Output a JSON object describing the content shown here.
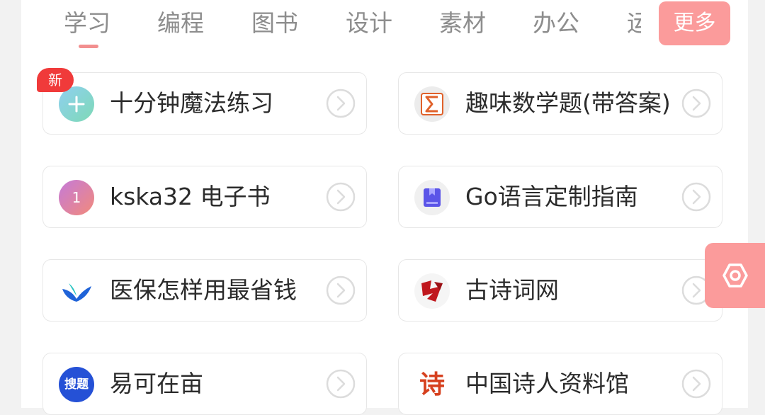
{
  "tabs": [
    "学习",
    "编程",
    "图书",
    "设计",
    "素材",
    "办公",
    "运"
  ],
  "more_label": "更多",
  "badge_new": "新",
  "cards": [
    {
      "title": "十分钟魔法练习",
      "icon": "plus-circle-icon"
    },
    {
      "title": "趣味数学题(带答案)",
      "icon": "sigma-icon"
    },
    {
      "title": "kska32 电子书",
      "icon": "number-one-icon",
      "icon_text": "1"
    },
    {
      "title": "Go语言定制指南",
      "icon": "bookmark-icon"
    },
    {
      "title": "医保怎样用最省钱",
      "icon": "bird-logo-icon"
    },
    {
      "title": "古诗词网",
      "icon": "red-calligraphy-icon"
    },
    {
      "title": "易可在亩",
      "icon": "search-logo-icon",
      "icon_text": "搜题"
    },
    {
      "title": "中国诗人资料馆",
      "icon": "poem-calligraphy-icon",
      "icon_text": "诗"
    }
  ],
  "colors": {
    "accent": "#fb9b9b",
    "badge": "#f03a3a",
    "text": "#2b2b2b",
    "tab_text": "#8d8d8d",
    "card_border": "#e7e7e7"
  }
}
